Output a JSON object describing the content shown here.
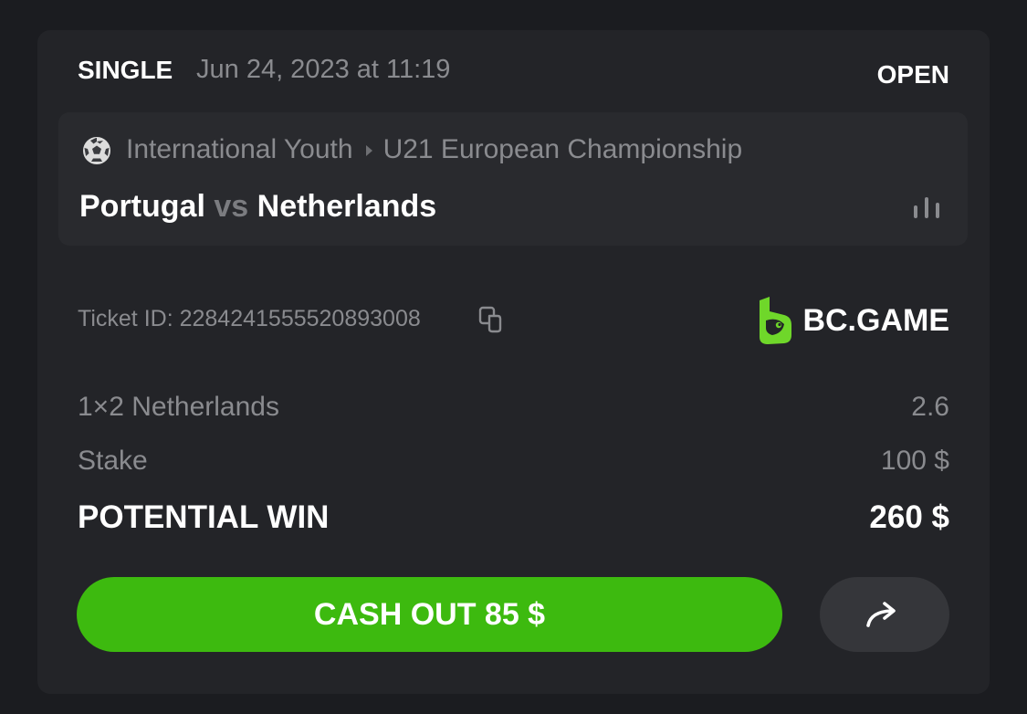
{
  "bet": {
    "type": "SINGLE",
    "date": "Jun 24, 2023 at 11:19",
    "status": "OPEN"
  },
  "match": {
    "sport_icon": "soccer-ball-icon",
    "category": "International Youth",
    "tournament": "U21 European Championship",
    "home_team": "Portugal",
    "vs": "vs",
    "away_team": "Netherlands",
    "stats_icon": "bar-chart-icon"
  },
  "ticket": {
    "label": "Ticket ID: 2284241555520893008",
    "copy_icon": "copy-icon"
  },
  "brand": {
    "name": "BC.GAME",
    "logo_color": "#6fd72a"
  },
  "selection": {
    "market": "1×2 Netherlands",
    "odds": "2.6"
  },
  "stake": {
    "label": "Stake",
    "value": "100 $"
  },
  "potential_win": {
    "label": "POTENTIAL WIN",
    "value": "260 $"
  },
  "actions": {
    "cashout_label": "CASH OUT 85 $",
    "cashout_color": "#3dba0f",
    "share_icon": "share-arrow-icon"
  }
}
